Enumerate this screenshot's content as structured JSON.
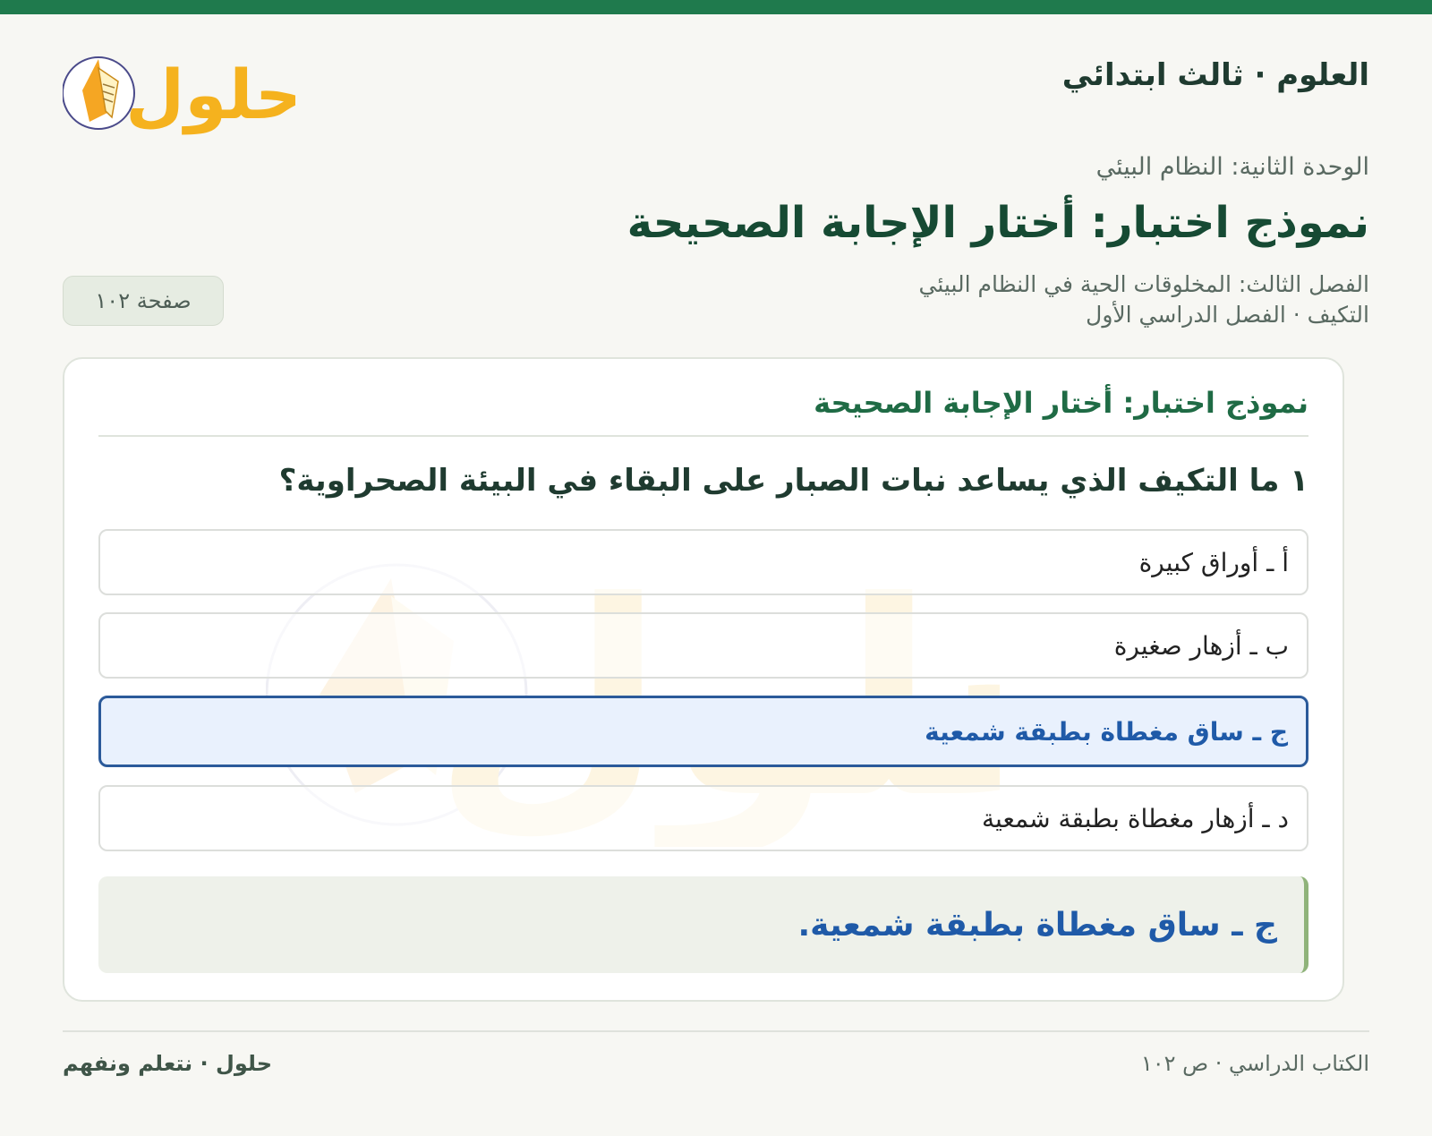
{
  "header": {
    "subject": "العلوم · ثالث ابتدائي",
    "logo_text": "حلول"
  },
  "unit": "الوحدة الثانية: النظام البيئي",
  "main_title": "نموذج اختبار: أختار الإجابة الصحيحة",
  "chapter": {
    "line1": "الفصل الثالث: المخلوقات الحية في النظام البيئي",
    "line2": "التكيف · الفصل الدراسي الأول"
  },
  "page_badge": "صفحة ١٠٢",
  "card": {
    "title": "نموذج اختبار: أختار الإجابة الصحيحة",
    "question": "١ ما التكيف الذي يساعد نبات الصبار على البقاء في البيئة الصحراوية؟",
    "options": [
      {
        "label": "أ ـ أوراق كبيرة",
        "selected": false
      },
      {
        "label": "ب ـ أزهار صغيرة",
        "selected": false
      },
      {
        "label": "ج ـ ساق مغطاة بطبقة شمعية",
        "selected": true
      },
      {
        "label": "د ـ أزهار مغطاة بطبقة شمعية",
        "selected": false
      }
    ],
    "answer": "ج ـ ساق مغطاة بطبقة شمعية."
  },
  "footer": {
    "right": "الكتاب الدراسي · ص ١٠٢",
    "left": "حلول · نتعلم ونفهم"
  },
  "colors": {
    "brand_green": "#1f7a4d",
    "selected_blue": "#1f5aa8",
    "logo_orange": "#f5a623"
  }
}
